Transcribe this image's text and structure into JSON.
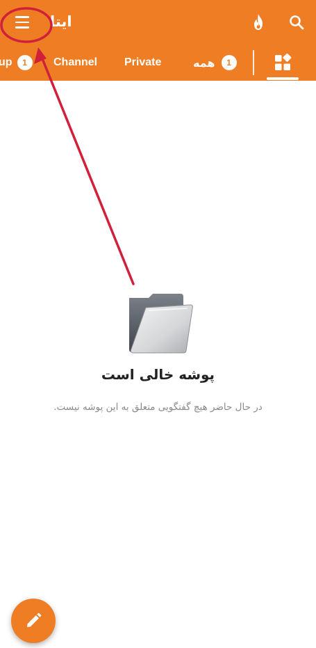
{
  "app": {
    "title": "ایتا",
    "accent_color": "#ee7d24"
  },
  "header": {
    "menu_icon": "hamburger-menu-icon",
    "flame_icon": "flame-icon",
    "search_icon": "search-icon"
  },
  "tabs": [
    {
      "label": "Group",
      "visible_text": "up",
      "badge": "1"
    },
    {
      "label": "Channel",
      "badge": ""
    },
    {
      "label": "Private",
      "badge": ""
    },
    {
      "label": "همه",
      "badge": "1"
    }
  ],
  "folders_tab": {
    "icon": "folders-grid-icon",
    "active": true
  },
  "empty_state": {
    "icon": "empty-folder-icon",
    "title": "پوشه خالی است",
    "description": "در حال حاضر هیچ گفتگویی متعلق به این پوشه نیست."
  },
  "fab": {
    "icon": "pencil-icon"
  },
  "annotation": {
    "color": "#d0203a"
  }
}
